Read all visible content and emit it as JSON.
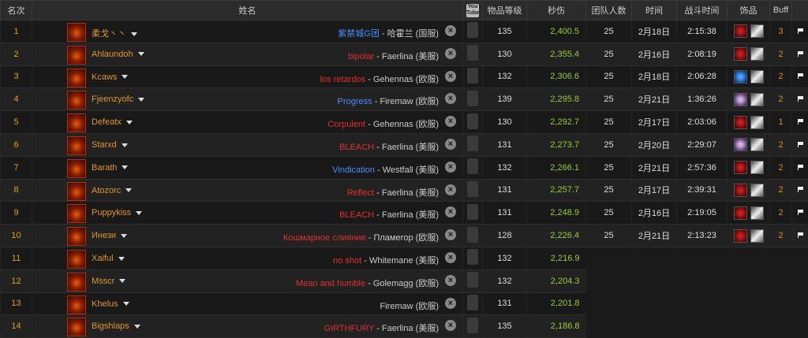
{
  "headers": {
    "rank": "名次",
    "name": "姓名",
    "youtube": "You Tube",
    "ilvl": "物品等级",
    "dps": "秒伤",
    "raid": "团队人数",
    "date": "时间",
    "duration": "战斗时间",
    "trinkets": "饰品",
    "buff": "Buff"
  },
  "rows": [
    {
      "rank": "1",
      "name": "柔戈丶丶",
      "guild": "紫禁城G团",
      "guild_color": "#4a8cff",
      "server": " - 哈霍兰 (国服)",
      "ilvl": "135",
      "dps": "2,400.5",
      "raid": "25",
      "date": "2月18日",
      "duration": "2:15:38",
      "trinkets": [
        "red",
        "gold"
      ],
      "buff": "3"
    },
    {
      "rank": "2",
      "name": "Ahlaundoh",
      "guild": "bipolar",
      "guild_color": "#e03030",
      "server": " - Faerlina (美服)",
      "ilvl": "130",
      "dps": "2,355.4",
      "raid": "25",
      "date": "2月16日",
      "duration": "2:08:19",
      "trinkets": [
        "red",
        "gold"
      ],
      "buff": "2"
    },
    {
      "rank": "3",
      "name": "Kcaws",
      "guild": "los retardos",
      "guild_color": "#e03030",
      "server": " - Gehennas (欧服)",
      "ilvl": "132",
      "dps": "2,306.6",
      "raid": "25",
      "date": "2月18日",
      "duration": "2:06:28",
      "trinkets": [
        "blue",
        "gold"
      ],
      "buff": "2"
    },
    {
      "rank": "4",
      "name": "Fjeenzyofc",
      "guild": "Progress",
      "guild_color": "#4a8cff",
      "server": " - Firemaw (欧服)",
      "ilvl": "139",
      "dps": "2,295.8",
      "raid": "25",
      "date": "2月21日",
      "duration": "1:36:26",
      "trinkets": [
        "purple",
        "gold"
      ],
      "buff": "2"
    },
    {
      "rank": "5",
      "name": "Defeatx",
      "guild": "Corpulent",
      "guild_color": "#e03030",
      "server": " - Gehennas (欧服)",
      "ilvl": "130",
      "dps": "2,292.7",
      "raid": "25",
      "date": "2月17日",
      "duration": "2:03:06",
      "trinkets": [
        "red",
        "gold"
      ],
      "buff": "1"
    },
    {
      "rank": "6",
      "name": "Starxd",
      "guild": "BLEACH",
      "guild_color": "#e03030",
      "server": " - Faerlina (美服)",
      "ilvl": "131",
      "dps": "2,273.7",
      "raid": "25",
      "date": "2月20日",
      "duration": "2:29:07",
      "trinkets": [
        "purple",
        "gold"
      ],
      "buff": "2"
    },
    {
      "rank": "7",
      "name": "Barath",
      "guild": "Vindication",
      "guild_color": "#4a8cff",
      "server": " - Westfall (美服)",
      "ilvl": "132",
      "dps": "2,266.1",
      "raid": "25",
      "date": "2月21日",
      "duration": "2:57:36",
      "trinkets": [
        "red",
        "gold"
      ],
      "buff": "2"
    },
    {
      "rank": "8",
      "name": "Atozorc",
      "guild": "Reflect",
      "guild_color": "#e03030",
      "server": " - Faerlina (美服)",
      "ilvl": "131",
      "dps": "2,257.7",
      "raid": "25",
      "date": "2月17日",
      "duration": "2:39:31",
      "trinkets": [
        "red",
        "gold"
      ],
      "buff": "2"
    },
    {
      "rank": "9",
      "name": "Puppykiss",
      "guild": "BLEACH",
      "guild_color": "#e03030",
      "server": " - Faerlina (美服)",
      "ilvl": "131",
      "dps": "2,248.9",
      "raid": "25",
      "date": "2月16日",
      "duration": "2:19:05",
      "trinkets": [
        "red",
        "gold"
      ],
      "buff": "2"
    },
    {
      "rank": "10",
      "name": "Инези",
      "guild": "Кошмарное слияние",
      "guild_color": "#e03030",
      "server": " - Пламегор (欧服)",
      "ilvl": "128",
      "dps": "2,226.4",
      "raid": "25",
      "date": "2月21日",
      "duration": "2:13:23",
      "trinkets": [
        "red",
        "gold"
      ],
      "buff": "2"
    },
    {
      "rank": "11",
      "name": "Xaiful",
      "guild": "no shot",
      "guild_color": "#e03030",
      "server": " - Whitemane (美服)",
      "ilvl": "132",
      "dps": "2,216.9",
      "raid": "",
      "date": "",
      "duration": "",
      "trinkets": [],
      "buff": ""
    },
    {
      "rank": "12",
      "name": "Msscr",
      "guild": "Mean and humble",
      "guild_color": "#e03030",
      "server": " - Golemagg (欧服)",
      "ilvl": "132",
      "dps": "2,204.3",
      "raid": "",
      "date": "",
      "duration": "",
      "trinkets": [],
      "buff": ""
    },
    {
      "rank": "13",
      "name": "Khelus",
      "guild": "",
      "guild_color": "#e03030",
      "server": "Firemaw (欧服)",
      "ilvl": "131",
      "dps": "2,201.8",
      "raid": "",
      "date": "",
      "duration": "",
      "trinkets": [],
      "buff": ""
    },
    {
      "rank": "14",
      "name": "Bigshlaps",
      "guild": "GIRTHFURY",
      "guild_color": "#e03030",
      "server": " - Faerlina (美服)",
      "ilvl": "135",
      "dps": "2,186.8",
      "raid": "",
      "date": "",
      "duration": "",
      "trinkets": [],
      "buff": ""
    }
  ]
}
